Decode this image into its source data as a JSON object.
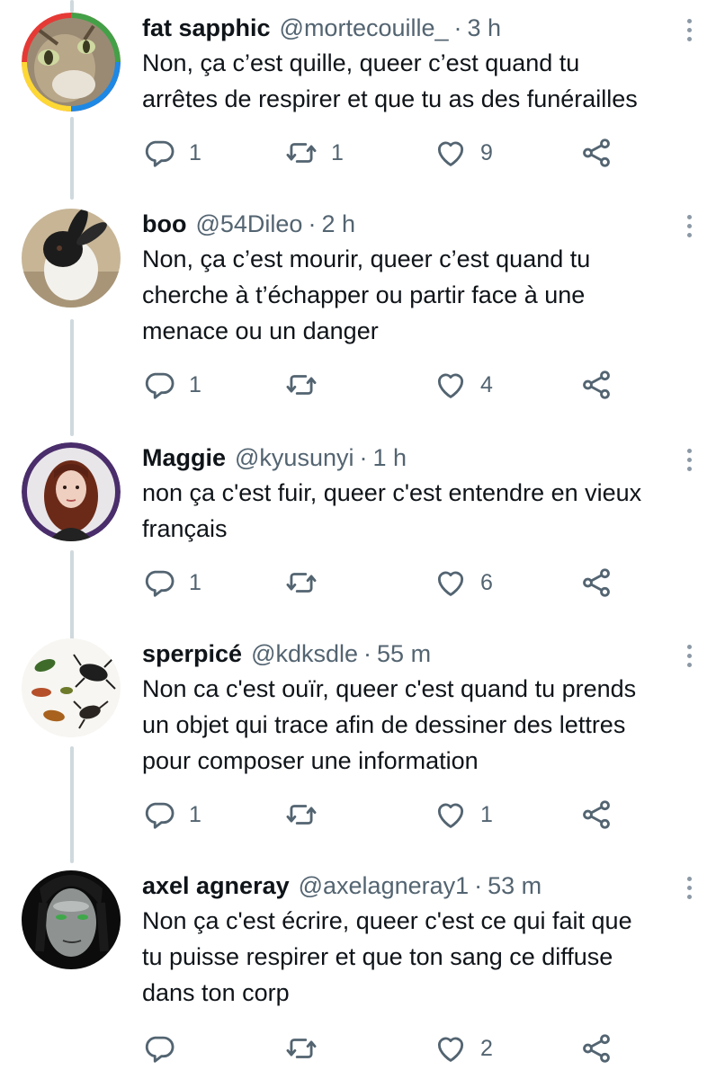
{
  "tweets": [
    {
      "name": "fat sapphic",
      "handle": "@mortecouille_",
      "time": "3 h",
      "text_lines": [
        "Non, ça c’est quille, queer c’est quand tu",
        "arrêtes de respirer et que tu as des funérailles"
      ],
      "replies": "1",
      "retweets": "1",
      "likes": "9",
      "avatar": "cat-avatar"
    },
    {
      "name": "boo",
      "handle": "@54Dileo",
      "time": "2 h",
      "text_lines": [
        "Non, ça c’est mourir, queer c’est quand tu",
        "cherche à t’échapper ou partir face à une",
        "menace ou un danger"
      ],
      "replies": "1",
      "retweets": "",
      "likes": "4",
      "avatar": "rabbit-avatar"
    },
    {
      "name": "Maggie",
      "handle": "@kyusunyi",
      "time": "1 h",
      "text_lines": [
        "non ça c'est fuir, queer c'est entendre en vieux",
        "français"
      ],
      "replies": "1",
      "retweets": "",
      "likes": "6",
      "avatar": "portrait-avatar"
    },
    {
      "name": "sperpicé",
      "handle": "@kdksdle",
      "time": "55 m",
      "text_lines": [
        "Non ca c'est ouïr, queer c'est quand tu prends",
        "un objet qui trace afin de dessiner des lettres",
        "pour composer une information"
      ],
      "replies": "1",
      "retweets": "",
      "likes": "1",
      "avatar": "beetles-avatar"
    },
    {
      "name": "axel agneray",
      "handle": "@axelagneray1",
      "time": "53 m",
      "text_lines": [
        "Non ça c'est écrire, queer c'est ce qui fait que",
        "tu puisse respirer et que ton sang ce diffuse",
        "dans ton corp"
      ],
      "replies": "",
      "retweets": "",
      "likes": "2",
      "avatar": "face-avatar"
    }
  ],
  "separator": "·",
  "colors": {
    "text": "#0f1419",
    "secondary": "#536471",
    "icon": "#536471",
    "thread_line": "#cfd9de"
  },
  "icons": {
    "reply": "reply-icon",
    "retweet": "retweet-icon",
    "like": "heart-icon",
    "share": "share-icon",
    "more": "more-options-icon"
  }
}
